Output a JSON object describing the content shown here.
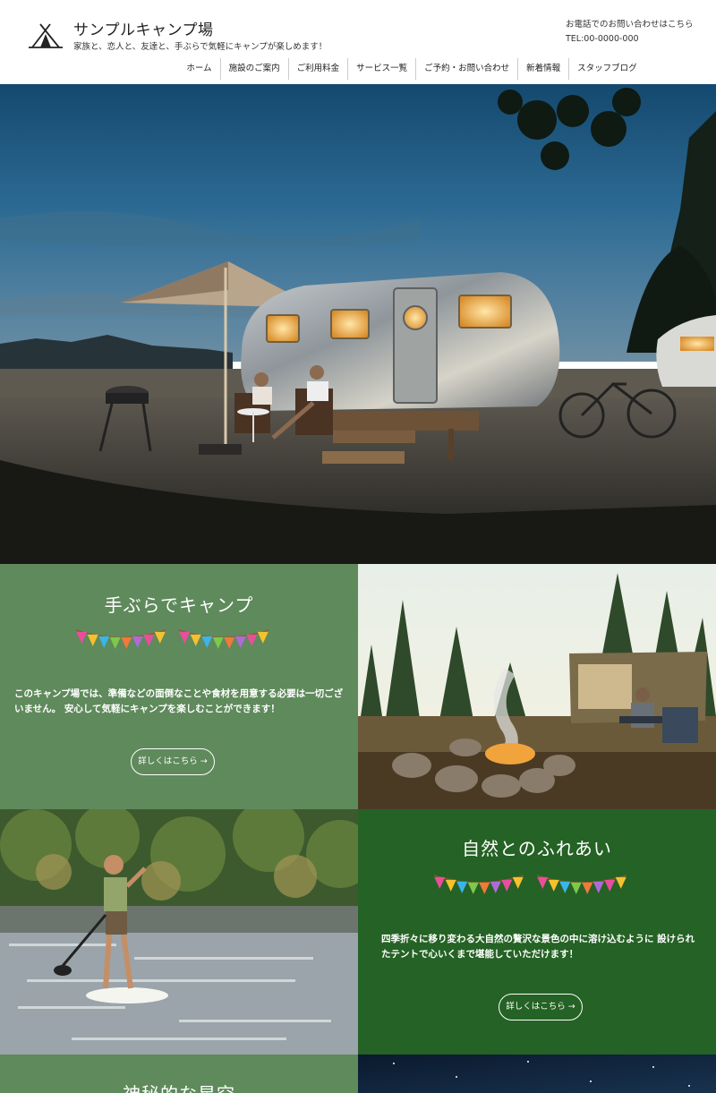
{
  "header": {
    "site_title": "サンプルキャンプ場",
    "tagline": "家族と、恋人と、友達と、手ぶらで気軽にキャンプが楽しめます！",
    "contact_line1": "お電話でのお問い合わせはこちら",
    "contact_line2": "TEL:00-0000-000"
  },
  "nav": {
    "items": [
      "ホーム",
      "施設のご案内",
      "ご利用料金",
      "サービス一覧",
      "ご予約・お問い合わせ",
      "新着情報",
      "スタッフブログ"
    ]
  },
  "sections": [
    {
      "heading": "手ぶらでキャンプ",
      "body": "このキャンプ場では、準備などの面倒なことや食材を用意する必要は一切ございません。 安心して気軽にキャンプを楽しむことができます！",
      "button": "詳しくはこちら →",
      "bg_color": "#5f8a5c"
    },
    {
      "heading": "自然とのふれあい",
      "body": "四季折々に移り変わる大自然の贅沢な景色の中に溶け込むように 設けられたテントで心いくまで堪能していただけます！",
      "button": "詳しくはこちら →",
      "bg_color": "#256225"
    },
    {
      "heading": "神秘的な星空",
      "bg_color": "#5f8a5c"
    }
  ],
  "icons": {
    "logo": "tent-icon",
    "bunting": "bunting-flags-icon"
  },
  "colors": {
    "green_light": "#5f8a5c",
    "green_dark": "#256225",
    "text": "#222222"
  }
}
